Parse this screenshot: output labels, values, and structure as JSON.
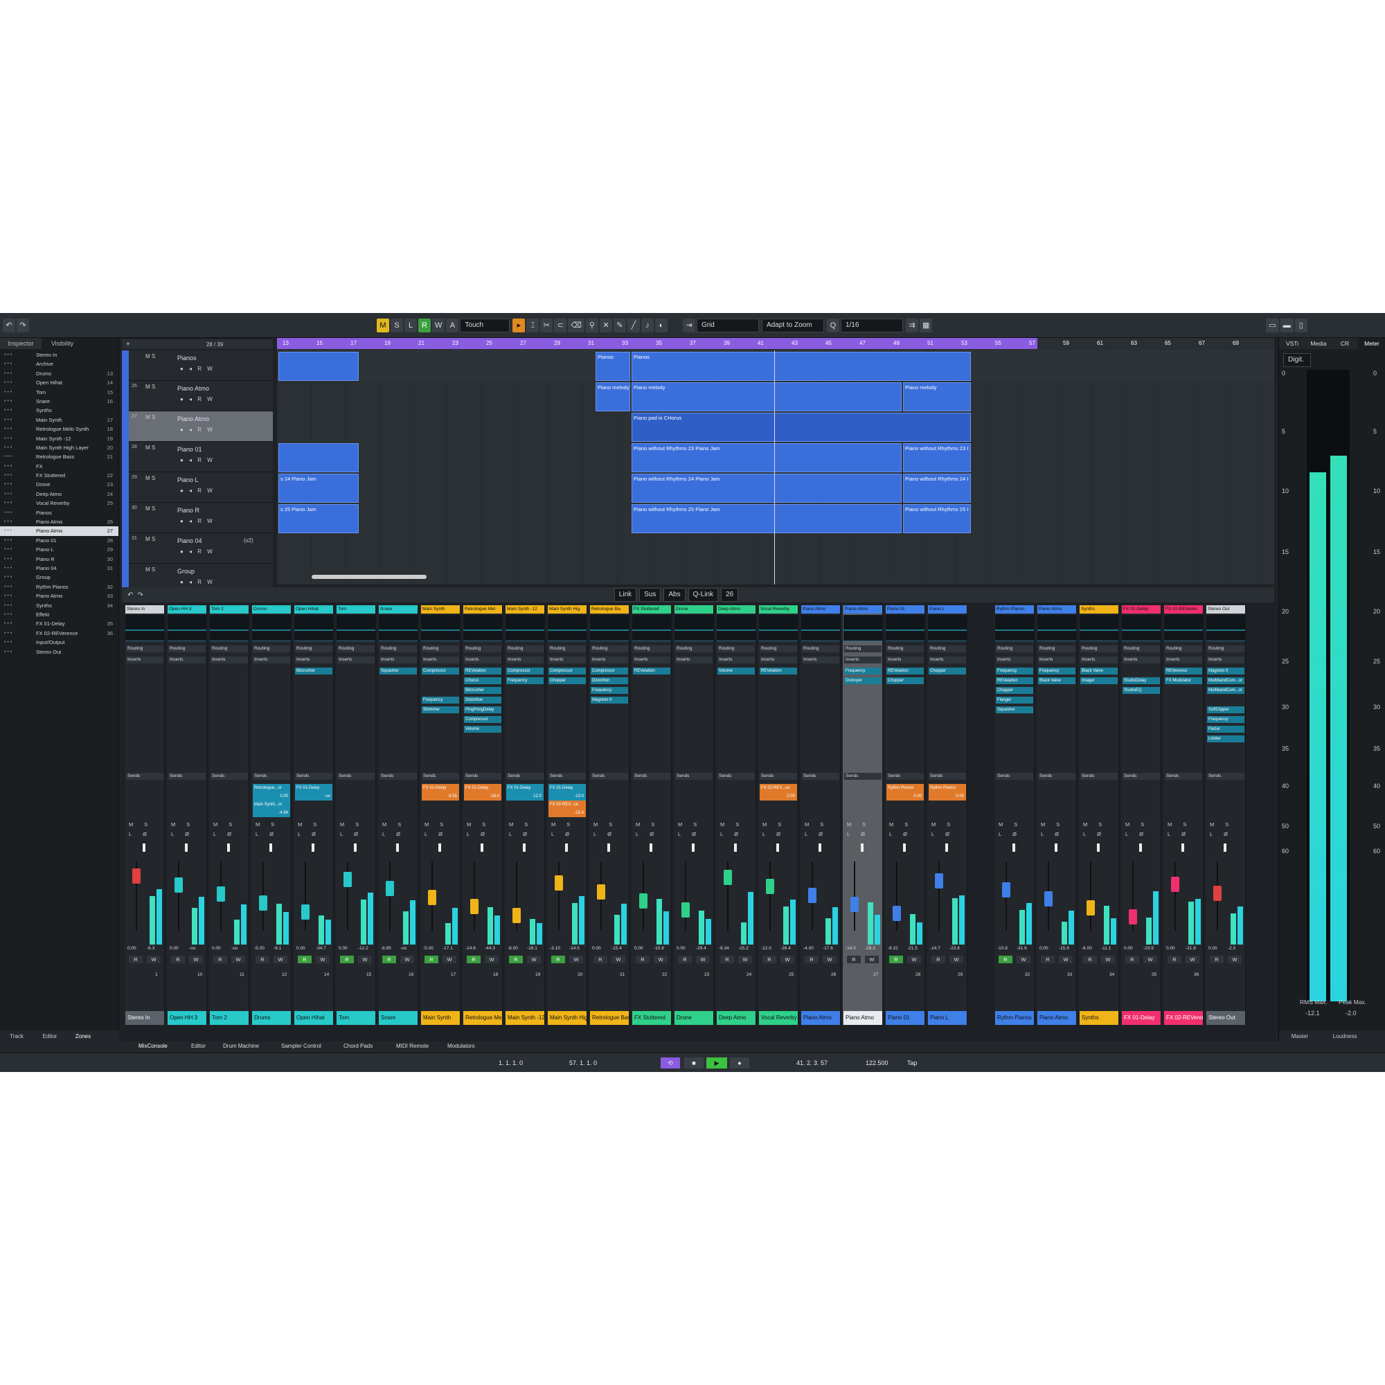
{
  "toolbar": {
    "buttons": [
      "M",
      "S",
      "L",
      "R",
      "W",
      "A"
    ],
    "automation_mode": "Touch",
    "snap": "Grid",
    "zoom": "Adapt to Zoom",
    "quantize": "1/16"
  },
  "leftzone": {
    "tabs": [
      "Inspector",
      "Visibility"
    ],
    "track_counter": "28 / 39",
    "items": [
      {
        "name": "Stereo In",
        "num": ""
      },
      {
        "name": "Archive",
        "num": ""
      },
      {
        "name": "Drums",
        "num": "13"
      },
      {
        "name": "Open Hihat",
        "num": "14"
      },
      {
        "name": "Tom",
        "num": "15"
      },
      {
        "name": "Snare",
        "num": "16"
      },
      {
        "name": "Synths",
        "num": ""
      },
      {
        "name": "Main Synth",
        "num": "17"
      },
      {
        "name": "Retrologue Melo Synth",
        "num": "18"
      },
      {
        "name": "Main Synth -12",
        "num": "19"
      },
      {
        "name": "Main Synth High Layer",
        "num": "20"
      },
      {
        "name": "Retrologue Bass",
        "num": "21"
      },
      {
        "name": "FX",
        "num": ""
      },
      {
        "name": "FX Stuttered",
        "num": "22"
      },
      {
        "name": "Drone",
        "num": "23"
      },
      {
        "name": "Deep Atmo",
        "num": "24"
      },
      {
        "name": "Vocal Reverby",
        "num": "25"
      },
      {
        "name": "Pianos",
        "num": ""
      },
      {
        "name": "Piano Atmo",
        "num": "26"
      },
      {
        "name": "Piano Atmo",
        "num": "27"
      },
      {
        "name": "Piano 01",
        "num": "28"
      },
      {
        "name": "Piano L",
        "num": "29"
      },
      {
        "name": "Piano R",
        "num": "30"
      },
      {
        "name": "Piano 04",
        "num": "31"
      },
      {
        "name": "Group",
        "num": ""
      },
      {
        "name": "Rythm Pianos",
        "num": "32"
      },
      {
        "name": "Piano Atmo",
        "num": "33"
      },
      {
        "name": "Synths",
        "num": "34"
      },
      {
        "name": "Effekt",
        "num": ""
      },
      {
        "name": "FX 01-Delay",
        "num": "35"
      },
      {
        "name": "FX 02-REVerence",
        "num": "36"
      },
      {
        "name": "Input/Output",
        "num": ""
      },
      {
        "name": "Stereo Out",
        "num": ""
      }
    ],
    "bottom_tabs": [
      "Track",
      "Editor",
      "Zones"
    ]
  },
  "tracks": [
    {
      "num": "",
      "name": "Pianos"
    },
    {
      "num": "26",
      "name": "Piano Atmo"
    },
    {
      "num": "27",
      "name": "Piano Atmo"
    },
    {
      "num": "28",
      "name": "Piano 01"
    },
    {
      "num": "29",
      "name": "Piano L"
    },
    {
      "num": "30",
      "name": "Piano R"
    },
    {
      "num": "31",
      "name": "Piano 04",
      "extra": "(v2)"
    },
    {
      "num": "",
      "name": "Group"
    }
  ],
  "ruler": [
    "13",
    "15",
    "17",
    "19",
    "21",
    "23",
    "25",
    "27",
    "29",
    "31",
    "33",
    "35",
    "37",
    "39",
    "41",
    "43",
    "45",
    "47",
    "49",
    "51",
    "53",
    "55",
    "57",
    "59",
    "61",
    "63",
    "65",
    "67",
    "69"
  ],
  "parts": {
    "pianos1": "Pianos",
    "pianos2": "Pianos",
    "melody1": "Piano melody",
    "melody2": "Piano melody",
    "melody3": "Piano melody",
    "pad": "Piano pad in CHorus",
    "r23a": "Piano without Rhythms 23 Piano Jam",
    "r23b": "Piano without Rhythms 23 I",
    "jam24": "s 24 Piano Jam",
    "r24a": "Piano without Rhythms 24 Piano Jam",
    "r24b": "Piano without Rhythms 24 I",
    "jam25": "s 25 Piano Jam",
    "r25a": "Piano without Rhythms 25 Piano Jam",
    "r25b": "Piano without Rhythms 25 I"
  },
  "mixtool": {
    "link": "Link",
    "sus": "Sus",
    "abs": "Abs",
    "qlink": "Q-Link",
    "count": "26"
  },
  "strips": [
    {
      "name": "Stereo In",
      "color": "#cfd4d8",
      "num": "1",
      "l": "0.00",
      "r": "-6.3",
      "ins": [],
      "snd": []
    },
    {
      "name": "Open HH 3",
      "color": "#27c9c9",
      "num": "10",
      "l": "0.00",
      "r": "-oo",
      "ins": [],
      "snd": []
    },
    {
      "name": "Tom 2",
      "color": "#27c9c9",
      "num": "11",
      "l": "0.00",
      "r": "-oo",
      "ins": [],
      "snd": []
    },
    {
      "name": "Drums",
      "color": "#27c9c9",
      "num": "12",
      "l": "-5.00",
      "r": "-9.1",
      "ins": [],
      "snd": [
        {
          "t": "Retrologue...or",
          "v": "0.00",
          "c": "b"
        },
        {
          "t": "Main Synth...or",
          "v": "-4.94",
          "c": "b"
        }
      ]
    },
    {
      "name": "Open Hihat",
      "color": "#27c9c9",
      "num": "14",
      "l": "0.00",
      "r": "-34.7",
      "ins": [
        "Bitcrusher"
      ],
      "snd": [
        {
          "t": "FX 01-Delay",
          "v": "-oo",
          "c": "b"
        }
      ]
    },
    {
      "name": "Tom",
      "color": "#27c9c9",
      "num": "15",
      "l": "0.00",
      "r": "-12.2",
      "ins": [],
      "snd": []
    },
    {
      "name": "Snare",
      "color": "#27c9c9",
      "num": "16",
      "l": "-8.85",
      "r": "-oo",
      "ins": [
        "Squasher"
      ],
      "snd": []
    },
    {
      "name": "Main Synth",
      "color": "#f0b418",
      "num": "17",
      "l": "-5.00",
      "r": "-17.1",
      "ins": [
        "Compressor",
        "",
        "",
        "Frequency",
        "Shimmer"
      ],
      "snd": [
        {
          "t": "FX 01-Delay",
          "v": "-9.55",
          "c": "o"
        }
      ]
    },
    {
      "name": "Retrologue Mel.",
      "color": "#f0b418",
      "num": "18",
      "l": "-14.6",
      "r": "-44.3",
      "ins": [
        "REVelation",
        "Chorus",
        "Bitcrusher",
        "Distortion",
        "PingPongDelay",
        "Compressor",
        "Volume"
      ],
      "snd": [
        {
          "t": "FX 01-Delay",
          "v": "-18.0",
          "c": "o"
        }
      ]
    },
    {
      "name": "Main Synth -12",
      "color": "#f0b418",
      "num": "19",
      "l": "-8.00",
      "r": "-18.1",
      "ins": [
        "Compressor",
        "Frequency"
      ],
      "snd": [
        {
          "t": "FX 01-Delay",
          "v": "-12.0",
          "c": "b"
        }
      ]
    },
    {
      "name": "Main Synth Hig.",
      "color": "#f0b418",
      "num": "20",
      "l": "-3.10",
      "r": "-14.5",
      "ins": [
        "Compressor",
        "Chopper"
      ],
      "snd": [
        {
          "t": "FX 01-Delay",
          "v": "-13.0",
          "c": "b"
        },
        {
          "t": "FX 02-REV...ce",
          "v": "-25.4",
          "c": "o"
        }
      ]
    },
    {
      "name": "Retrologue Ba.",
      "color": "#f0b418",
      "num": "21",
      "l": "0.00",
      "r": "-15.4",
      "ins": [
        "Compressor",
        "Distortion",
        "Frequency",
        "Magneto II"
      ],
      "snd": []
    },
    {
      "name": "FX Stuttered",
      "color": "#2fd08a",
      "num": "22",
      "l": "0.00",
      "r": "-15.8",
      "ins": [
        "REVelation"
      ],
      "snd": []
    },
    {
      "name": "Drone",
      "color": "#2fd08a",
      "num": "23",
      "l": "0.00",
      "r": "-29.4",
      "ins": [],
      "snd": []
    },
    {
      "name": "Deep Atmo",
      "color": "#2fd08a",
      "num": "24",
      "l": "-6.34",
      "r": "-15.2",
      "ins": [
        "Volume"
      ],
      "snd": []
    },
    {
      "name": "Vocal Reverby",
      "color": "#2fd08a",
      "num": "25",
      "l": "-12.0",
      "r": "-26.4",
      "ins": [
        "REVelation"
      ],
      "snd": [
        {
          "t": "FX 02-REV...ce",
          "v": "0.00",
          "c": "o"
        }
      ]
    },
    {
      "name": "Piano Atmo",
      "color": "#3f7fe8",
      "num": "26",
      "l": "-4.00",
      "r": "-17.6",
      "ins": [],
      "snd": []
    },
    {
      "name": "Piano Atmo",
      "color": "#3f7fe8",
      "num": "27",
      "l": "-14.0",
      "r": "-28.3",
      "ins": [
        "Frequency",
        "Distroyer"
      ],
      "snd": [],
      "sel": true
    },
    {
      "name": "Piano 01",
      "color": "#3f7fe8",
      "num": "28",
      "l": "-8.31",
      "r": "-21.5",
      "ins": [
        "REVelation",
        "Chopper"
      ],
      "snd": [
        {
          "t": "Rythm Pianos",
          "v": "0.00",
          "c": "o"
        }
      ]
    },
    {
      "name": "Piano L",
      "color": "#3f7fe8",
      "num": "29",
      "l": "-14.7",
      "r": "-23.8",
      "ins": [
        "Chopper"
      ],
      "snd": [
        {
          "t": "Rythm Pianos",
          "v": "0.00",
          "c": "o"
        }
      ]
    },
    {
      "name": "Rythm Pianos",
      "color": "#3f7fe8",
      "num": "32",
      "l": "-10.8",
      "r": "-31.6",
      "ins": [
        "Frequency",
        "REVelation",
        "Chopper",
        "Flanger",
        "Squasher"
      ],
      "snd": []
    },
    {
      "name": "Piano Atmo",
      "color": "#3f7fe8",
      "num": "33",
      "l": "0.00",
      "r": "-15.9",
      "ins": [
        "Frequency",
        "Black Valve"
      ],
      "snd": []
    },
    {
      "name": "Synths",
      "color": "#f0b418",
      "num": "34",
      "l": "-6.00",
      "r": "-11.1",
      "ins": [
        "Black Valve",
        "Imager"
      ],
      "snd": []
    },
    {
      "name": "FX 01-Delay",
      "color": "#f0306e",
      "num": "35",
      "l": "0.00",
      "r": "-23.9",
      "ins": [
        "",
        "StudioDelay",
        "StudioEQ"
      ],
      "snd": []
    },
    {
      "name": "FX 02-REVeren.",
      "color": "#f0306e",
      "num": "36",
      "l": "0.00",
      "r": "-21.8",
      "ins": [
        "REVerence",
        "FX Modulator"
      ],
      "snd": []
    },
    {
      "name": "Stereo Out",
      "color": "#cfd4d8",
      "num": "",
      "l": "0.00",
      "r": "-2.0",
      "ins": [
        "Magneto II",
        "MultibandCom...or",
        "MultibandCom...or",
        "",
        "SoftClipper",
        "Frequency",
        "Paizer",
        "Limiter"
      ],
      "snd": []
    }
  ],
  "bottom_names": [
    "Stereo In",
    "Open HH 3",
    "Tom 2",
    "Drums",
    "Open Hihat",
    "Tom",
    "Snare",
    "Main Synth",
    "Retrologue Melo Synth",
    "Main Synth -12",
    "Main Synth High Layer",
    "Retrologue Bass",
    "FX Stuttered",
    "Drone",
    "Deep Atmo",
    "Vocal Reverby",
    "Piano Atmo",
    "Piano Atmo",
    "Piano 01",
    "Piano L",
    "Rythm Pianos",
    "Piano Atmo",
    "Synths",
    "FX 01-Delay",
    "FX 02-REVerence",
    "Stereo Out"
  ],
  "labels": {
    "routing": "Routing",
    "inserts": "Inserts",
    "sends": "Sends"
  },
  "lower_tabs": [
    "MixConsole",
    "Editor",
    "Drum Machine",
    "Sampler Control",
    "Chord Pads",
    "MIDI Remote",
    "Modulators"
  ],
  "rightzone": {
    "tabs": [
      "VSTi",
      "Media",
      "CR",
      "Meter"
    ],
    "digit": "Digit.",
    "scale": [
      "0",
      "5",
      "10",
      "15",
      "20",
      "25",
      "30",
      "35",
      "40",
      "50",
      "60"
    ],
    "rms_label": "RMS Max.",
    "peak_label": "Peak Max.",
    "rms": "-12.1",
    "peak": "-2.0",
    "bottom": [
      "Master",
      "Loudness"
    ]
  },
  "transport": {
    "left_locator": "1. 1. 1.   0",
    "right_locator": "57. 1. 1.   0",
    "position": "41. 2. 3.  57",
    "tempo": "122.500",
    "tap": "Tap"
  }
}
